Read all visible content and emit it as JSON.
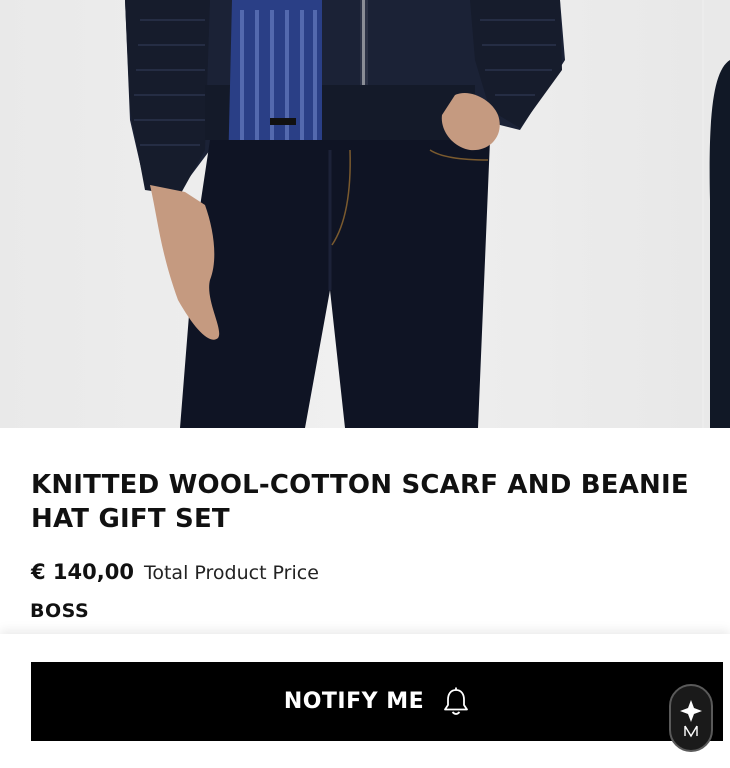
{
  "gallery": {
    "image_alt": "Model wearing navy knitted scarf, navy knit jacket and dark denim jeans"
  },
  "product": {
    "title": "KNITTED WOOL-COTTON SCARF AND BEANIE HAT GIFT SET",
    "price": "€ 140,00",
    "price_label": "Total Product Price",
    "brand": "BOSS"
  },
  "actions": {
    "notify_label": "NOTIFY ME"
  },
  "icons": {
    "notify": "bell-icon",
    "assistant": "assistant-logo-icon"
  },
  "colors": {
    "button_bg": "#000000",
    "button_text": "#ffffff",
    "page_bg": "#ffffff",
    "text": "#111111"
  }
}
